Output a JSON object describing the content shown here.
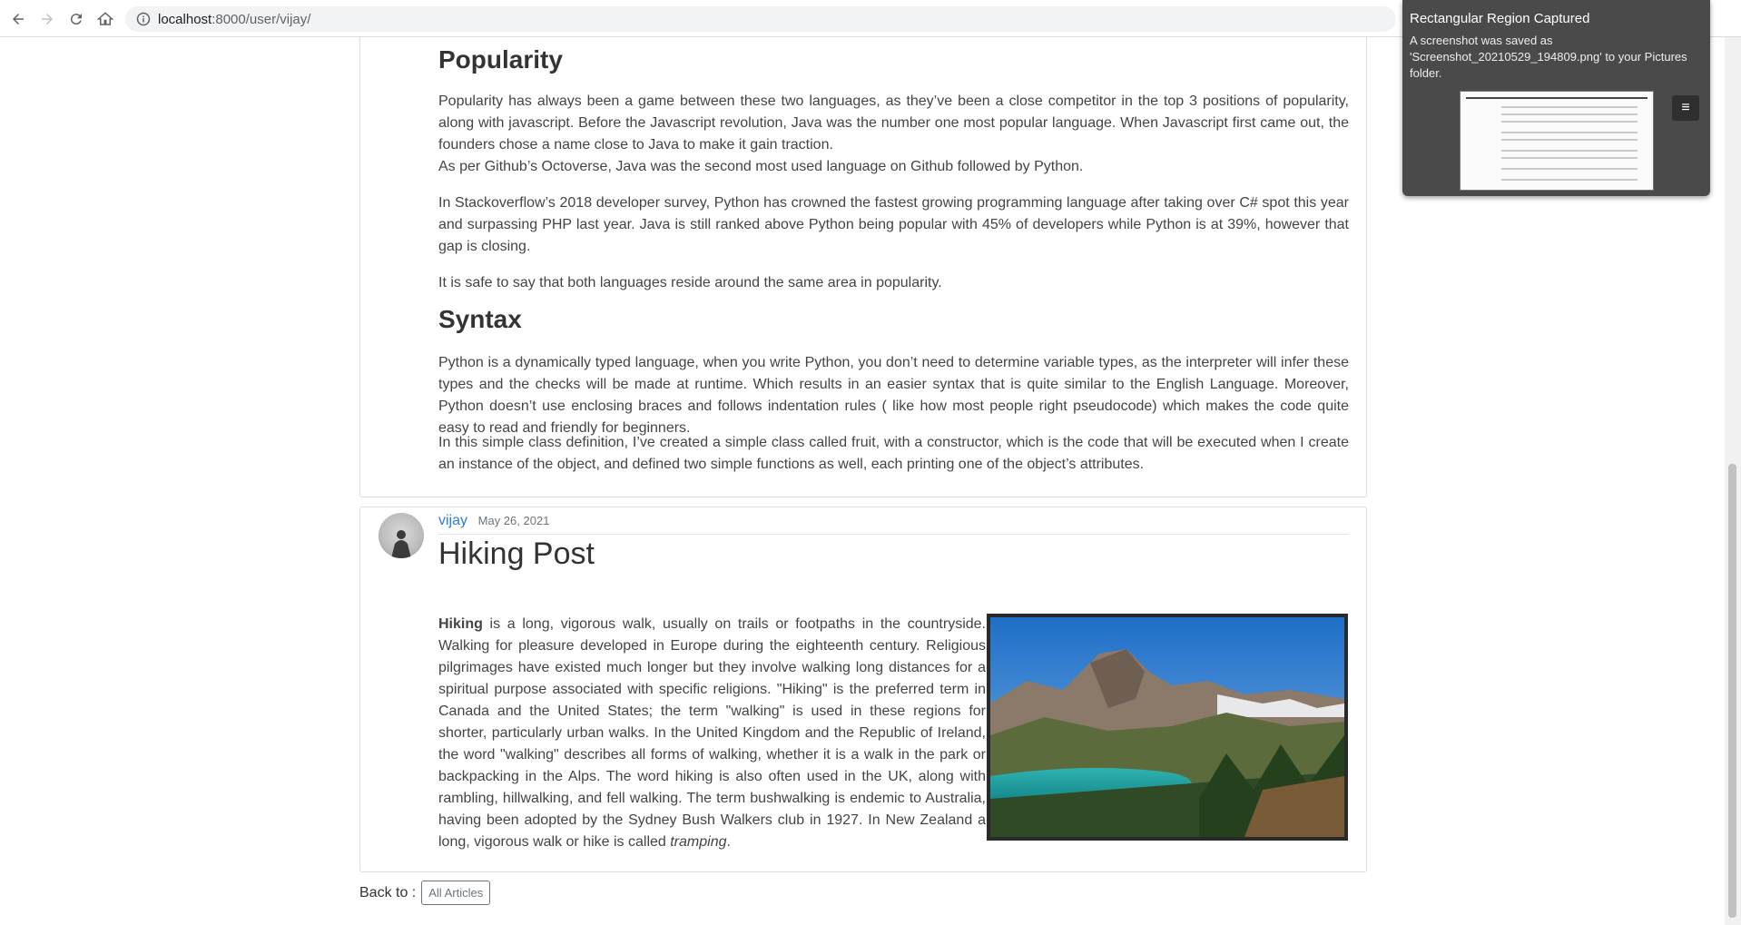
{
  "browser": {
    "url_host": "localhost",
    "url_path": ":8000/user/vijay/",
    "icons": [
      "back-icon",
      "forward-icon",
      "reload-icon",
      "home-icon",
      "info-icon"
    ]
  },
  "post1": {
    "partial_heading": "Popularity",
    "paragraphs": [
      "Popularity has always been a game between these two languages, as they’ve been a close competitor in the top 3 positions of popularity, along with javascript. Before the Javascript revolution, Java was the number one most popular language. When Javascript first came out, the founders chose a name close to Java to make it gain traction.",
      "As per Github’s Octoverse, Java was the second most used language on Github followed by Python.",
      "In Stackoverflow’s 2018 developer survey, Python has crowned the fastest growing programming language after taking over C# spot this year and surpassing PHP last year. Java is still ranked above Python being popular with 45% of developers while Python is at 39%, however that gap is closing.",
      "It is safe to say that both languages reside around the same area in popularity."
    ],
    "syntax_heading": "Syntax",
    "syntax_paragraphs": [
      "Python is a dynamically typed language, when you write Python, you don’t need to determine variable types, as the interpreter will infer these types and the checks will be made at runtime. Which results in an easier syntax that is quite similar to the English Language. Moreover, Python doesn’t use enclosing braces and follows indentation rules ( like how most people right pseudocode) which makes the code quite easy to read and friendly for beginners.",
      "In this simple class definition, I’ve created a simple class called fruit, with a constructor, which is the code that will be executed when I create an instance of the object, and defined two simple functions as well, each printing one of the object’s attributes."
    ]
  },
  "post2": {
    "author": "vijay",
    "date": "May 26, 2021",
    "title": "Hiking Post",
    "lead_word": "Hiking",
    "body": " is a long, vigorous walk, usually on trails or footpaths in the countryside. Walking for pleasure developed in Europe during the eighteenth century. Religious pilgrimages have existed much longer but they involve walking long distances for a spiritual purpose associated with specific religions. \"Hiking\" is the preferred term in Canada and the United States; the term \"walking\" is used in these regions for shorter, particularly urban walks. In the United Kingdom and the Republic of Ireland, the word \"walking\" describes all forms of walking, whether it is a walk in the park or backpacking in the Alps. The word hiking is also often used in the UK, along with rambling, hillwalking, and fell walking. The term bushwalking is endemic to Australia, having been adopted by the Sydney Bush Walkers club in 1927. In New Zealand a long, vigorous walk or hike is called ",
    "end_word": "tramping",
    "end_punct": "."
  },
  "footer": {
    "back_label": "Back to :",
    "all_articles": "All Articles"
  },
  "notification": {
    "title": "Rectangular Region Captured",
    "body": "A screenshot was saved as 'Screenshot_20210529_194809.png' to your Pictures folder.",
    "menu_icon": "≡"
  }
}
